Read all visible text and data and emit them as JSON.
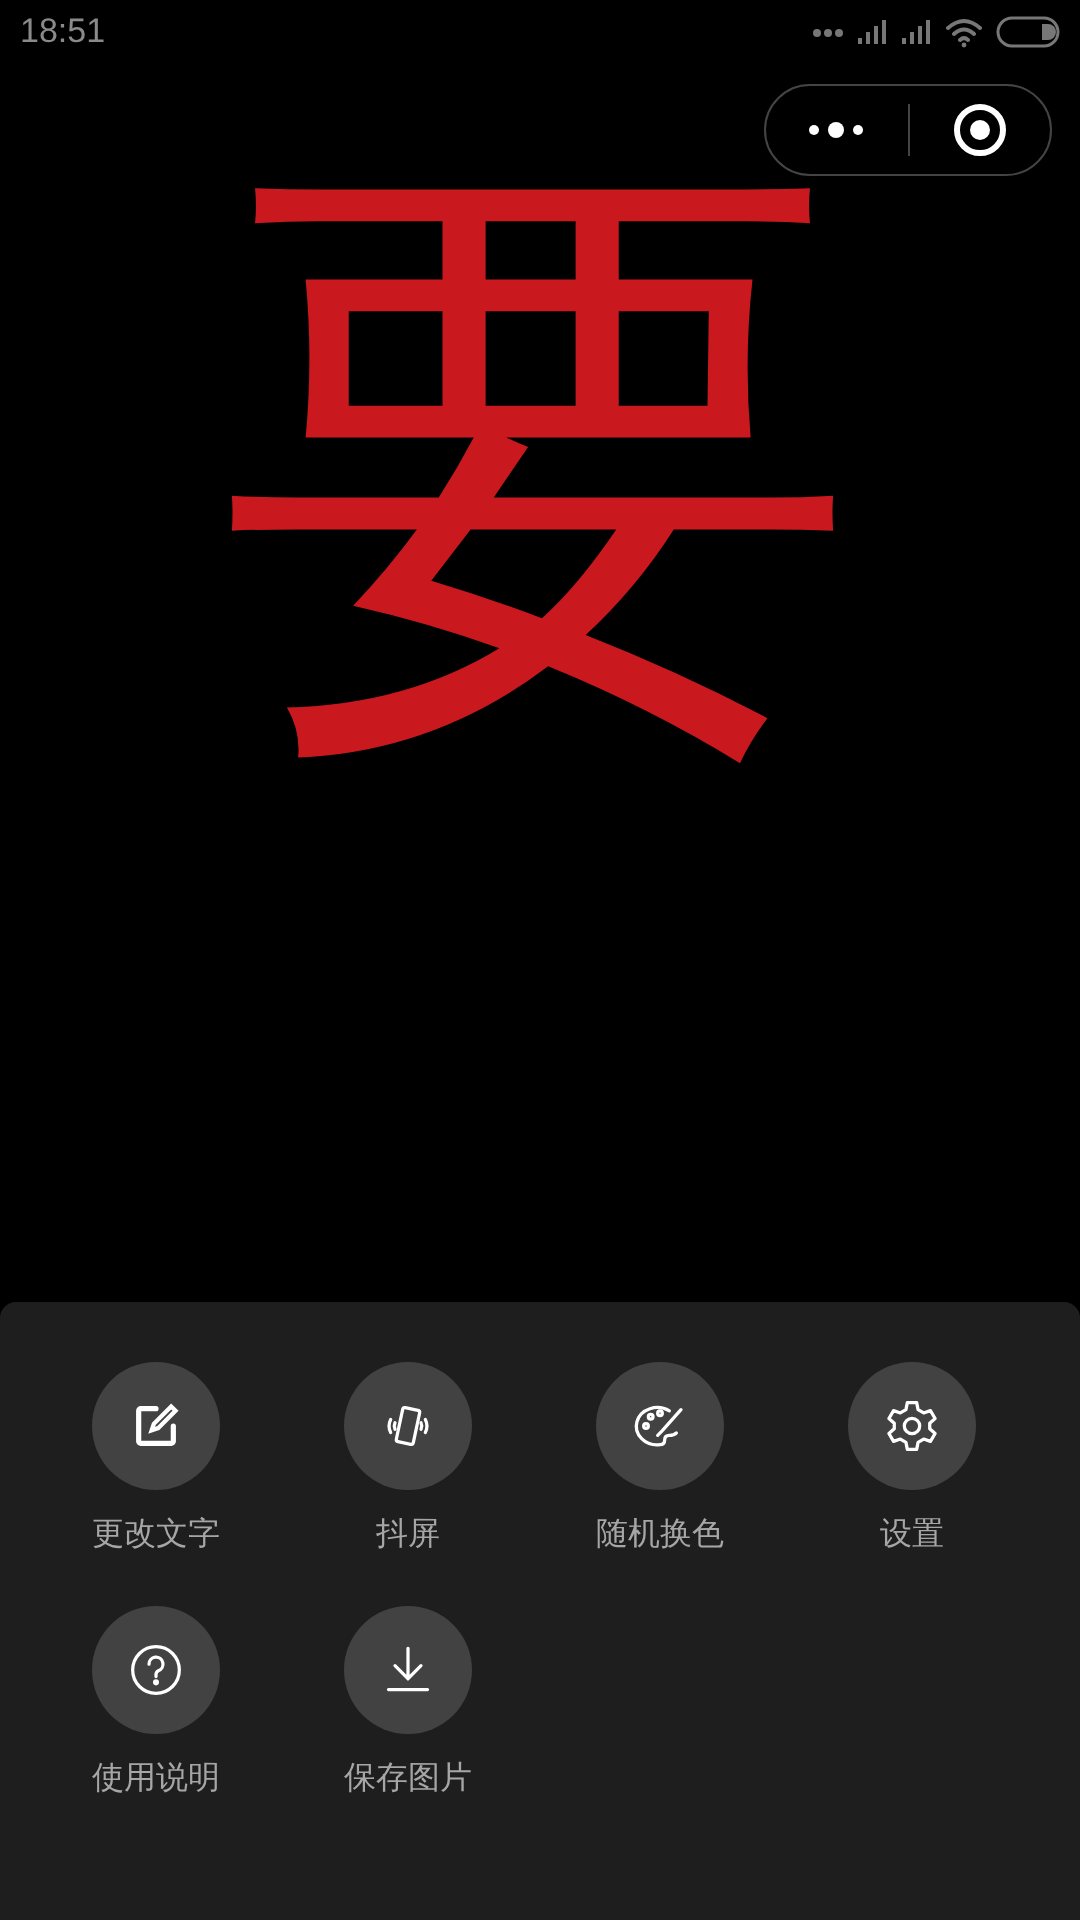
{
  "status_bar": {
    "time": "18:51"
  },
  "display_text": {
    "text": "要",
    "color": "#c9181e"
  },
  "menu": {
    "items": [
      {
        "label": "更改文字",
        "kind": "edit"
      },
      {
        "label": "抖屏",
        "kind": "shake"
      },
      {
        "label": "随机换色",
        "kind": "palette"
      },
      {
        "label": "设置",
        "kind": "settings"
      },
      {
        "label": "使用说明",
        "kind": "help"
      },
      {
        "label": "保存图片",
        "kind": "download"
      }
    ]
  }
}
